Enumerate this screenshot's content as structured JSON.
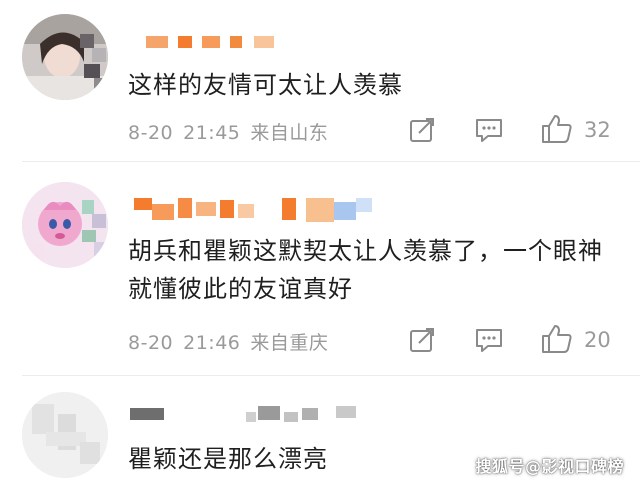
{
  "comments": [
    {
      "text": "这样的友情可太让人羡慕",
      "date": "8-20",
      "time": "21:45",
      "location": "来自山东",
      "likes": "32",
      "icons": {
        "share": "share-icon",
        "reply": "comment-icon",
        "like": "thumbs-up-icon"
      }
    },
    {
      "text": "胡兵和瞿颖这默契太让人羡慕了，一个眼神就懂彼此的友谊真好",
      "date": "8-20",
      "time": "21:46",
      "location": "来自重庆",
      "likes": "20",
      "icons": {
        "share": "share-icon",
        "reply": "comment-icon",
        "like": "thumbs-up-icon"
      }
    },
    {
      "text": "瞿颖还是那么漂亮"
    }
  ],
  "watermark": "搜狐号@影视口碑榜",
  "colors": {
    "meta_gray": "#9a9a9a",
    "text": "#1f1f1f",
    "mosaic_orange": "#f5823a",
    "mosaic_blue": "#8fb6e8"
  }
}
